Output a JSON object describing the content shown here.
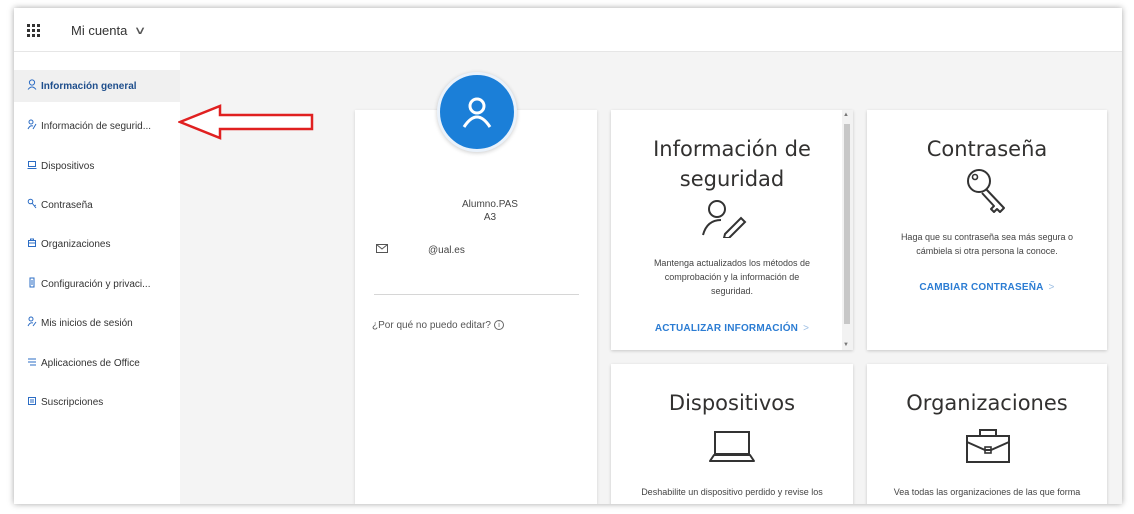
{
  "topbar": {
    "account_label": "Mi cuenta"
  },
  "sidebar": {
    "items": [
      {
        "label": "Información general",
        "icon": "user-icon",
        "glyph": "&#x2640;"
      },
      {
        "label": "Información de segurid...",
        "icon": "security-icon",
        "glyph": ""
      },
      {
        "label": "Dispositivos",
        "icon": "device-icon",
        "glyph": ""
      },
      {
        "label": "Contraseña",
        "icon": "key-icon",
        "glyph": ""
      },
      {
        "label": "Organizaciones",
        "icon": "organization-icon",
        "glyph": ""
      },
      {
        "label": "Configuración y privaci...",
        "icon": "privacy-icon",
        "glyph": ""
      },
      {
        "label": "Mis inicios de sesión",
        "icon": "signin-icon",
        "glyph": ""
      },
      {
        "label": "Aplicaciones de Office",
        "icon": "office-icon",
        "glyph": ""
      },
      {
        "label": "Suscripciones",
        "icon": "subscription-icon",
        "glyph": ""
      }
    ]
  },
  "profile": {
    "name": "Alumno.PAS",
    "subtitle": "A3",
    "email": "@ual.es",
    "why_label": "¿Por qué no puedo editar?"
  },
  "tiles": {
    "security": {
      "title_line1": "Información de",
      "title_line2": "seguridad",
      "desc_line1": "Mantenga actualizados los métodos de",
      "desc_line2": "comprobación y la información de",
      "desc_line3": "seguridad.",
      "link": "ACTUALIZAR INFORMACIÓN"
    },
    "password": {
      "title": "Contraseña",
      "desc_line1": "Haga que su contraseña sea más segura o",
      "desc_line2": "cámbiela si otra persona la conoce.",
      "link": "CAMBIAR CONTRASEÑA"
    },
    "devices": {
      "title": "Dispositivos",
      "desc": "Deshabilite un dispositivo perdido y revise los"
    },
    "organizations": {
      "title": "Organizaciones",
      "desc": "Vea todas las organizaciones de las que forma"
    }
  },
  "colors": {
    "accent": "#2b7cd3",
    "avatar": "#1b7fd8",
    "arrow": "#e02020"
  }
}
